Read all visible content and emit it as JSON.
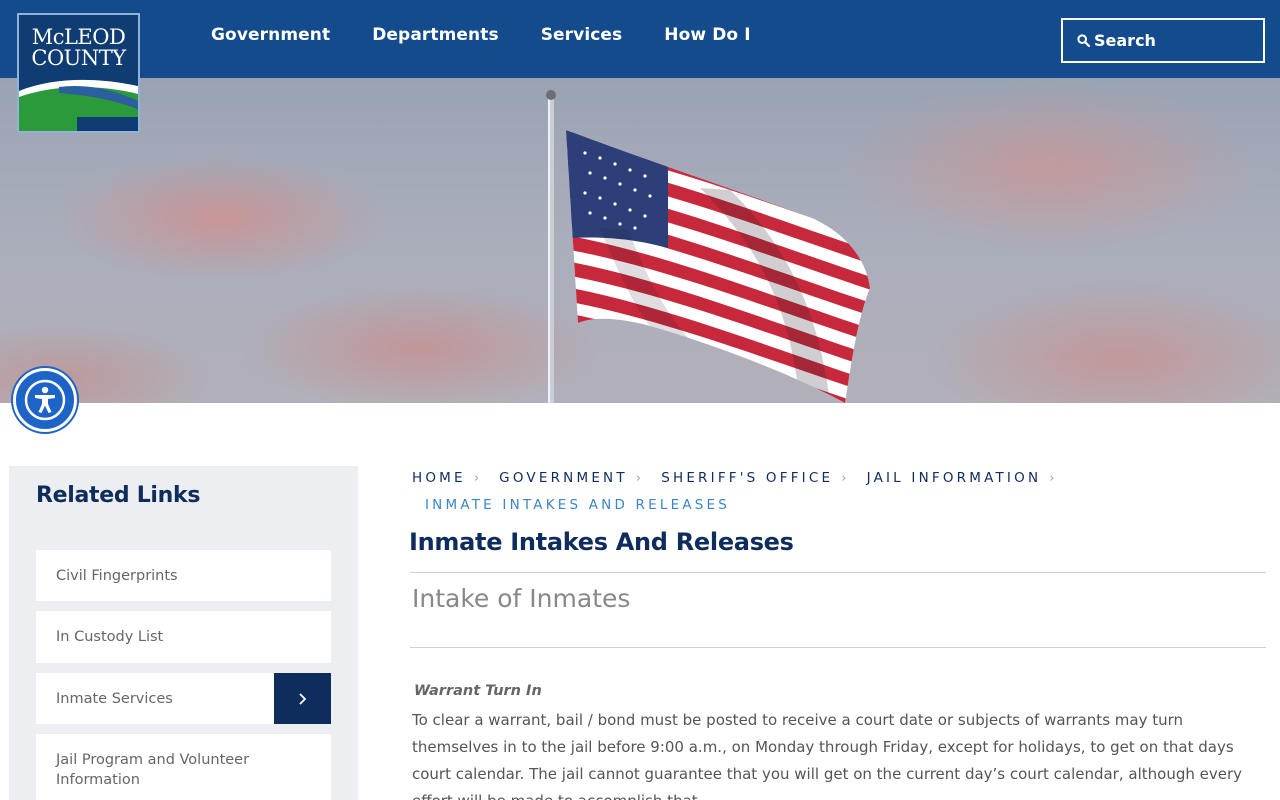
{
  "header": {
    "logo": {
      "line1": "McLEOD",
      "line2": "COUNTY"
    },
    "nav": [
      "Government",
      "Departments",
      "Services",
      "How Do I"
    ],
    "search": {
      "label": "Search",
      "icon": "search-icon"
    },
    "colors": {
      "header_bg": "#144b8c",
      "nav_text": "#ffffff"
    }
  },
  "hero": {
    "subject": "american-flag-image"
  },
  "accessibility": {
    "icon": "accessibility-icon",
    "color": "#1e63c8"
  },
  "sidebar": {
    "title": "Related Links",
    "links": [
      {
        "label": "Civil Fingerprints"
      },
      {
        "label": "In Custody List"
      },
      {
        "label": "Inmate Services",
        "has_submenu": true
      },
      {
        "label": "Jail Program and Volunteer Information"
      }
    ]
  },
  "breadcrumb": {
    "items": [
      "HOME",
      "GOVERNMENT",
      "SHERIFF'S OFFICE",
      "JAIL INFORMATION"
    ],
    "current": "INMATE INTAKES AND RELEASES"
  },
  "content": {
    "title": "Inmate Intakes And Releases",
    "subtitle": "Intake of Inmates",
    "section_label": "Warrant Turn In",
    "body": "To clear a warrant, bail / bond must be posted to receive a court date or subjects of warrants may turn themselves in to the jail before 9:00 a.m., on Monday through Friday, except for holidays, to get on that days court calendar.  The jail cannot guarantee that you will get on the current day’s court calendar, although every effort will be made to accomplish that."
  }
}
